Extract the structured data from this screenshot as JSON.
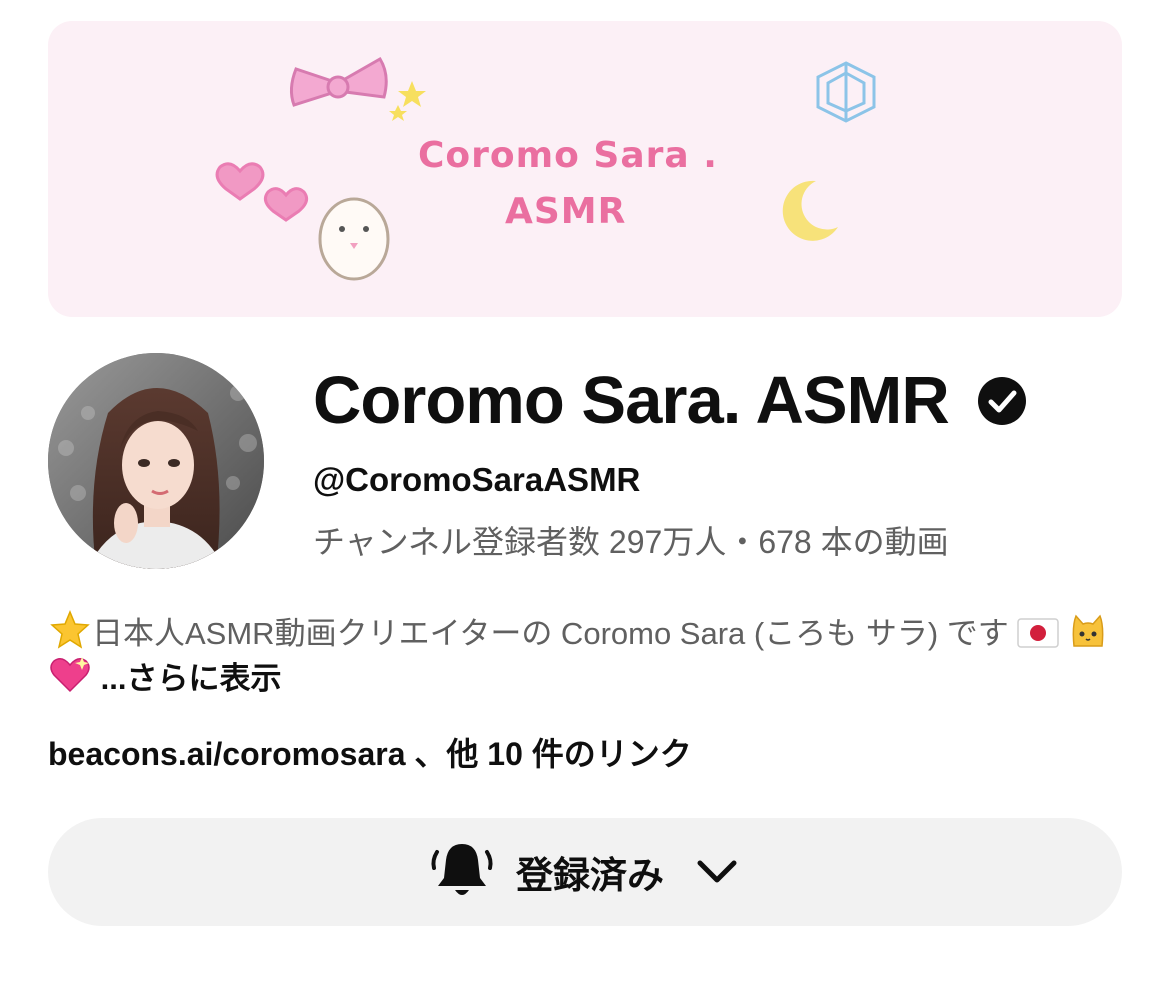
{
  "banner": {
    "line1": "Coromo Sara .",
    "line2": "ASMR"
  },
  "channel": {
    "name": "Coromo Sara. ASMR",
    "handle": "@CoromoSaraASMR",
    "stats": "チャンネル登録者数 297万人・678 本の動画"
  },
  "description": {
    "text": "日本人ASMR動画クリエイターの Coromo Sara (ころも サラ) です",
    "more_label": "...さらに表示"
  },
  "links": {
    "text": "beacons.ai/coromosara 、他 10 件のリンク"
  },
  "subscribe": {
    "label": "登録済み"
  },
  "icons": {
    "verified": "verified-check-icon",
    "bell": "notification-bell-icon",
    "chevron": "chevron-down-icon"
  },
  "colors": {
    "banner_bg": "#fcf0f6",
    "banner_text": "#ea6fa0",
    "secondary_text": "#606060",
    "button_bg": "#f2f2f2"
  }
}
